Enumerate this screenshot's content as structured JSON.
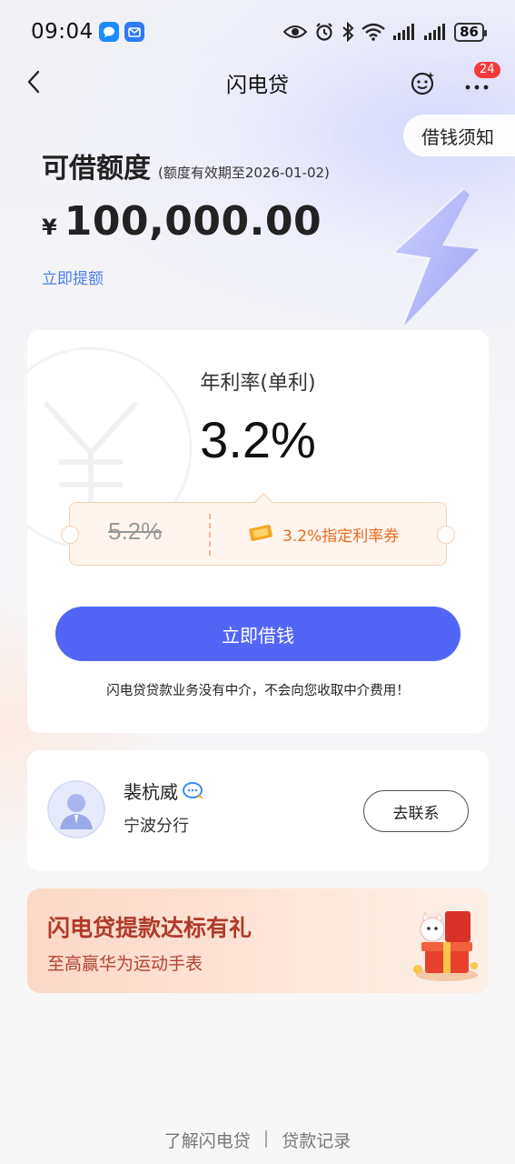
{
  "status_bar": {
    "time": "09:04",
    "battery": "86",
    "icons": [
      "message-app-icon",
      "mail-app-icon",
      "eye-icon",
      "alarm-icon",
      "bluetooth-icon",
      "wifi-icon",
      "signal-icon",
      "signal-icon",
      "battery-icon"
    ]
  },
  "nav": {
    "title": "闪电贷",
    "badge": "24"
  },
  "notice": {
    "label": "借钱须知"
  },
  "quota": {
    "title": "可借额度",
    "validity": "(额度有效期至2026-01-02)",
    "currency": "¥",
    "amount": "100,000.00",
    "raise_link": "立即提额"
  },
  "rate_card": {
    "label": "年利率(单利)",
    "value": "3.2%",
    "old_rate": "5.2%",
    "coupon_text": "3.2%指定利率券",
    "borrow_button": "立即借钱",
    "disclaimer": "闪电贷贷款业务没有中介，不会向您收取中介费用！"
  },
  "manager": {
    "name": "裴杭威",
    "branch": "宁波分行",
    "contact_button": "去联系"
  },
  "promo": {
    "title": "闪电贷提款达标有礼",
    "subtitle": "至高赢华为运动手表"
  },
  "footer": {
    "about": "了解闪电贷",
    "separator": "|",
    "records": "贷款记录"
  },
  "colors": {
    "primary_button": "#5266f5",
    "link": "#4a7ee8",
    "coupon_text": "#e96a1e",
    "promo_title": "#b03a2a",
    "badge": "#f23c3c"
  }
}
